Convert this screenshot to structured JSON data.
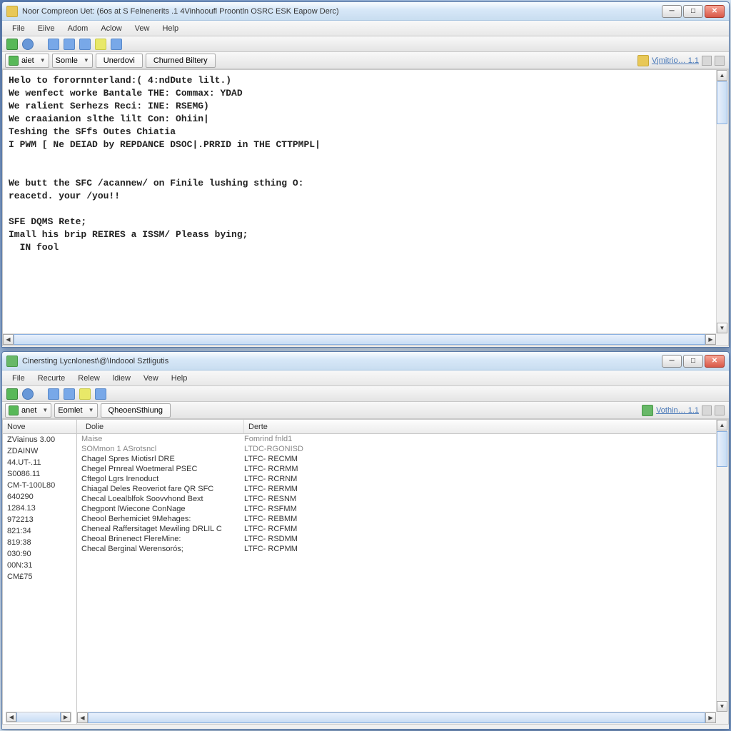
{
  "window1": {
    "title": "Noor Compreon Uet: (6os at S Felnenerits .1 4Vinhooufl Proontln OSRC ESK Eapow Derc)",
    "menu": [
      "File",
      "Eiive",
      "Adom",
      "Aclow",
      "Vew",
      "Help"
    ],
    "combo1": "aiet",
    "combo2": "Somle",
    "tab1": "Unerdovi",
    "tab2": "Churned Biltery",
    "badge": "Vjmitrio… 1.1",
    "editor": "Helo to forornnterland:( 4:ndDute lilt.)\nWe wenfect worke Bantale THE: Commax: YDAD\nWe ralient Serhezs Reci: INE: RSEMG)\nWe craaianion slthe lilt Con: Ohiin|\nTeshing the SFfs Outes Chiatia\nI PWM [ Ne DEIAD by REPDANCE DSOC|.PRRID in THE CTTPMPL|\n\n\nWe butt the SFC /acannew/ on Finile lushing sthing O:\nreacetd. your /you!!\n\nSFE DQMS Rete;\nImall his brip REIRES a ISSM/ Pleass bying;\n  IN fool"
  },
  "window2": {
    "title": "Cinersting Lycnlonest\\@\\Indoool Sztligutis",
    "menu": [
      "File",
      "Recurte",
      "Relew",
      "ldiew",
      "Vew",
      "Help"
    ],
    "combo1": "anet",
    "combo2": "Eomlet",
    "tab1": "QheoenSthiung",
    "badge": "Vothin… 1.1",
    "leftHeader": "Nove",
    "leftItems": [
      "ZViainus 3.00",
      "ZDAINW",
      "44.UT-.11",
      "S0086.11",
      "CM-T-100L80",
      "640290",
      "1284.13",
      "972213",
      "821:34",
      "819:38",
      "030:90",
      "00N:31",
      "CM£75"
    ],
    "colHeader1": "Dolie",
    "colHeader2": "Derte",
    "rows": [
      {
        "c1": "Maise",
        "c2": "Fomrind fnld1",
        "hdr": true
      },
      {
        "c1": "SOMmon 1 ASrotsncl",
        "c2": "LTDC-RGONISD",
        "hdr": true
      },
      {
        "c1": "Chagel Spres Miotisrl DRE",
        "c2": "LTFC- RECMM"
      },
      {
        "c1": "Chegel Prnreal Woetmeral PSEC",
        "c2": "LTFC- RCRMM"
      },
      {
        "c1": "Cftegol Lgrs Irenoduct",
        "c2": "LTFC- RCRNM"
      },
      {
        "c1": "Chiagal Deles Reoveriot fare QR SFC",
        "c2": "LTFC- RERMM"
      },
      {
        "c1": "Checal Loealblfok Soovvhond Bext",
        "c2": "LTFC- RESNM"
      },
      {
        "c1": "Chegpont lWiecone ConNage",
        "c2": "LTFC- RSFMM"
      },
      {
        "c1": "Cheool Berhemiciet 9Mehages:",
        "c2": "LTFC- REBMM"
      },
      {
        "c1": "Cheneal Raffersitaget Mewiling DRLIL C",
        "c2": "LTFC- RCFMM"
      },
      {
        "c1": "Cheoal Brinenect FlereMine:",
        "c2": "LTFC- RSDMM"
      },
      {
        "c1": "Checal Berginal Werensorós;",
        "c2": "LTFC- RCPMM"
      }
    ]
  }
}
